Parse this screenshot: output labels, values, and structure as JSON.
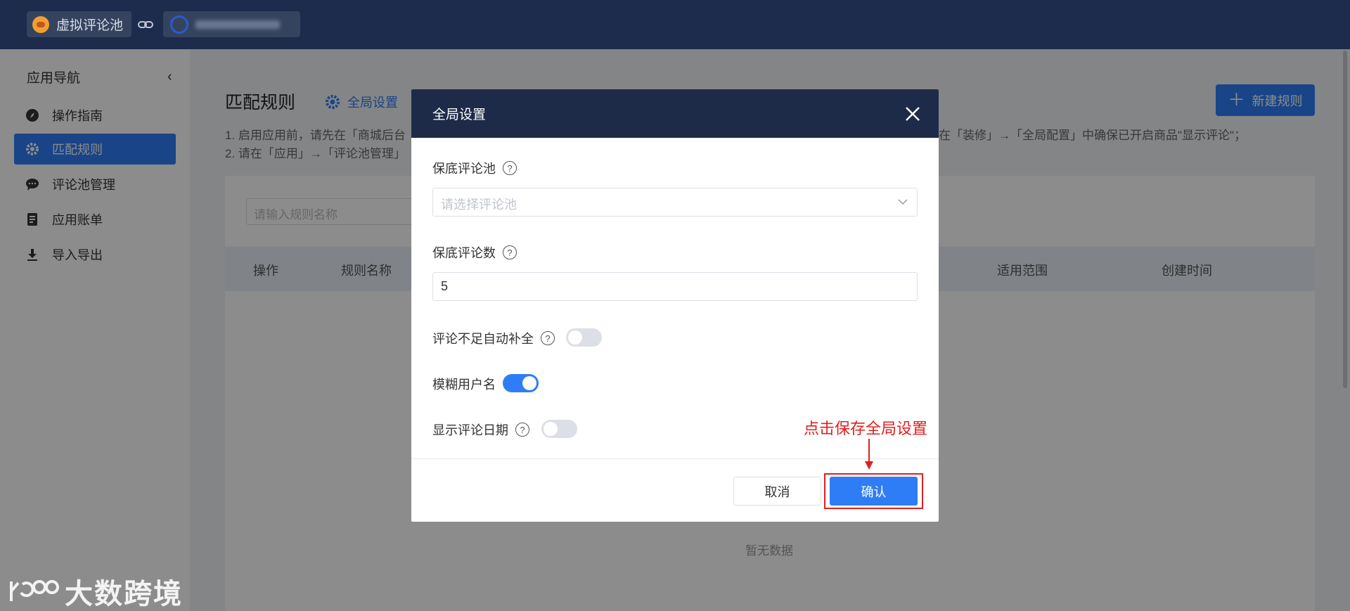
{
  "topbar": {
    "app_name": "虚拟评论池",
    "store_name_hidden": true
  },
  "sidebar": {
    "title": "应用导航",
    "items": [
      {
        "label": "操作指南",
        "icon": "compass-icon",
        "active": false
      },
      {
        "label": "匹配规则",
        "icon": "gear-icon",
        "active": true
      },
      {
        "label": "评论池管理",
        "icon": "chat-bubble-icon",
        "active": false
      },
      {
        "label": "应用账单",
        "icon": "bill-icon",
        "active": false
      },
      {
        "label": "导入导出",
        "icon": "download-icon",
        "active": false
      }
    ]
  },
  "main": {
    "title": "匹配规则",
    "global_settings_link": "全局设置",
    "new_rule_button": "新建规则",
    "tips": [
      "1. 启用应用前，请先在「商城后台",
      "2. 请在「应用」→「评论池管理」",
      "在「装修」→「全局配置」中确保已开启商品\"显示评论\"；"
    ],
    "search_placeholder": "请输入规则名称",
    "table_headers": [
      "操作",
      "规则名称",
      "适用范围",
      "创建时间"
    ],
    "empty_text": "暂无数据"
  },
  "modal": {
    "title": "全局设置",
    "fields": {
      "pool_label": "保底评论池",
      "pool_placeholder": "请选择评论池",
      "count_label": "保底评论数",
      "count_value": "5",
      "autofill_label": "评论不足自动补全",
      "autofill_on": false,
      "blur_name_label": "模糊用户名",
      "blur_name_on": true,
      "show_date_label": "显示评论日期",
      "show_date_on": false
    },
    "cancel_label": "取消",
    "confirm_label": "确认"
  },
  "annotation": {
    "text": "点击保存全局设置"
  },
  "watermark": {
    "text": "大数跨境"
  },
  "colors": {
    "topbar": "#1d2b4c",
    "primary": "#2f7df6",
    "annotation": "#e02020"
  }
}
